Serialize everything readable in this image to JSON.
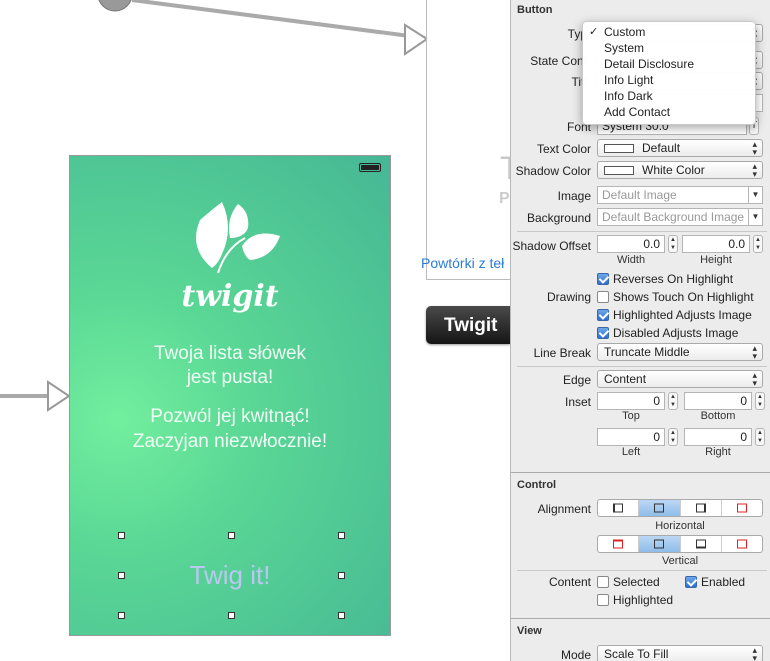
{
  "canvas": {
    "scene2": {
      "big_letter": "T",
      "small_letter": "P",
      "link_text": "Powtórki z teł"
    },
    "black_button_label": "Twigit",
    "phone": {
      "logo_text": "twigit",
      "message_line1": "Twoja lista słówek",
      "message_line2": "jest pusta!",
      "message_line3": "Pozwól jej kwitnąć!",
      "message_line4": "Zaczyjan niezwłocznie!",
      "button_label": "Twig it!"
    }
  },
  "inspector": {
    "button_section": {
      "title": "Button",
      "type_label": "Typ",
      "state_config_label": "State Conf",
      "title_label": "Titl",
      "font_label": "Font",
      "font_value": "System 30.0",
      "text_color_label": "Text Color",
      "text_color_value": "Default",
      "shadow_color_label": "Shadow Color",
      "shadow_color_value": "White Color",
      "image_label": "Image",
      "image_placeholder": "Default Image",
      "background_label": "Background",
      "background_placeholder": "Default Background Image",
      "shadow_offset_label": "Shadow Offset",
      "shadow_offset_width": "0.0",
      "shadow_offset_height": "0.0",
      "width_label": "Width",
      "height_label": "Height",
      "drawing_label": "Drawing",
      "reverses_on_highlight": "Reverses On Highlight",
      "shows_touch_on_highlight": "Shows Touch On Highlight",
      "highlighted_adjusts_image": "Highlighted Adjusts Image",
      "disabled_adjusts_image": "Disabled Adjusts Image",
      "line_break_label": "Line Break",
      "line_break_value": "Truncate Middle",
      "edge_label": "Edge",
      "edge_value": "Content",
      "inset_label": "Inset",
      "inset_top": "0",
      "inset_bottom": "0",
      "inset_left": "0",
      "inset_right": "0",
      "top_label": "Top",
      "bottom_label": "Bottom",
      "left_label": "Left",
      "right_label": "Right"
    },
    "control_section": {
      "title": "Control",
      "alignment_label": "Alignment",
      "horizontal_label": "Horizontal",
      "vertical_label": "Vertical",
      "content_label": "Content",
      "selected_label": "Selected",
      "enabled_label": "Enabled",
      "highlighted_label": "Highlighted"
    },
    "view_section": {
      "title": "View",
      "mode_label": "Mode",
      "mode_value": "Scale To Fill"
    },
    "type_menu": {
      "checkmark": "✓",
      "items": [
        "Custom",
        "System",
        "Detail Disclosure",
        "Info Light",
        "Info Dark",
        "Add Contact"
      ]
    }
  },
  "checkbox_states": {
    "reverses_on_highlight": true,
    "shows_touch_on_highlight": false,
    "highlighted_adjusts_image": true,
    "disabled_adjusts_image": true,
    "selected": false,
    "enabled": true,
    "highlighted": false
  },
  "colors": {
    "phone_gradient_light": "#73ef9f",
    "phone_gradient_dark": "#46b795",
    "selection_blue": "#8ebde9",
    "link_blue": "#2a7cd6"
  }
}
